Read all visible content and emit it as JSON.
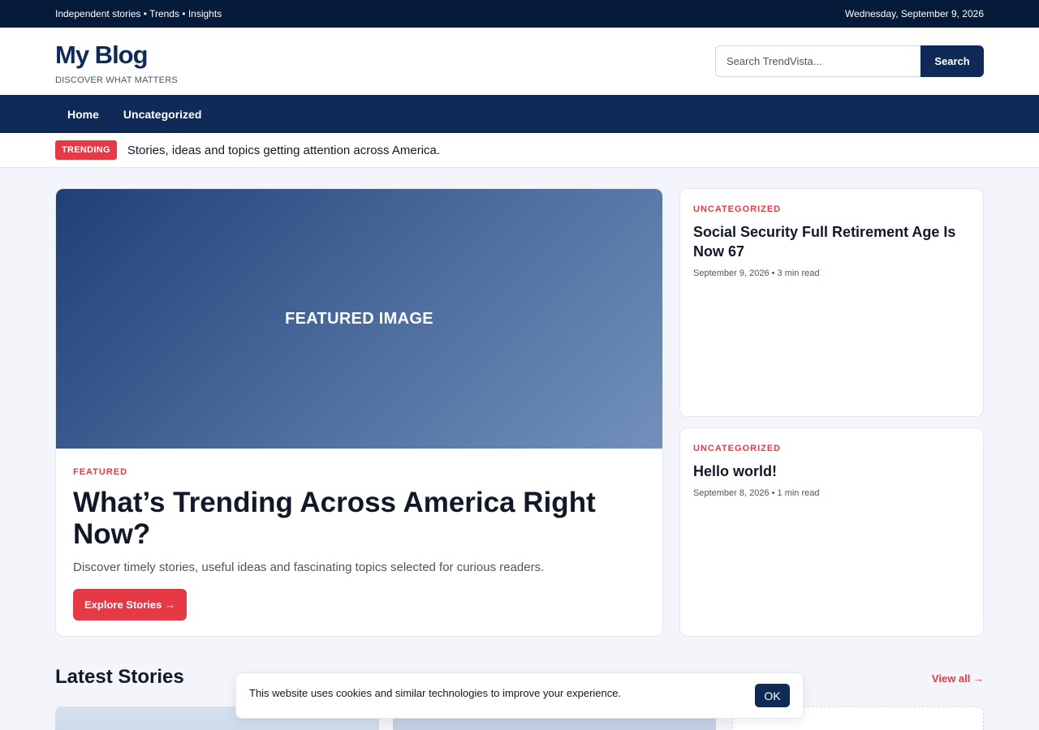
{
  "topbar": {
    "left": "Independent stories • Trends • Insights",
    "date": "Wednesday, September 9, 2026"
  },
  "header": {
    "logo": "My Blog",
    "tagline": "DISCOVER WHAT MATTERS",
    "search_placeholder": "Search TrendVista...",
    "search_button": "Search"
  },
  "nav": {
    "items": [
      "Home",
      "Uncategorized"
    ]
  },
  "trending": {
    "badge": "TRENDING",
    "text": "Stories, ideas and topics getting attention across America."
  },
  "featured": {
    "image_label": "FEATURED IMAGE",
    "kicker": "FEATURED",
    "title": "What’s Trending Across America Right Now?",
    "description": "Discover timely stories, useful ideas and fascinating topics selected for curious readers.",
    "cta": "Explore Stories →"
  },
  "side_posts": [
    {
      "category": "UNCATEGORIZED",
      "title": "Social Security Full Retirement Age Is Now 67",
      "meta": "September 9, 2026 • 3 min read"
    },
    {
      "category": "UNCATEGORIZED",
      "title": "Hello world!",
      "meta": "September 8, 2026 • 1 min read"
    }
  ],
  "latest": {
    "title": "Latest Stories",
    "view_all": "View all →"
  },
  "cookie": {
    "text": "This website uses cookies and similar technologies to improve your experience.",
    "ok": "OK"
  },
  "colors": {
    "navy": "#0f2a56",
    "topbar": "#061a3a",
    "accent": "#e63946"
  }
}
